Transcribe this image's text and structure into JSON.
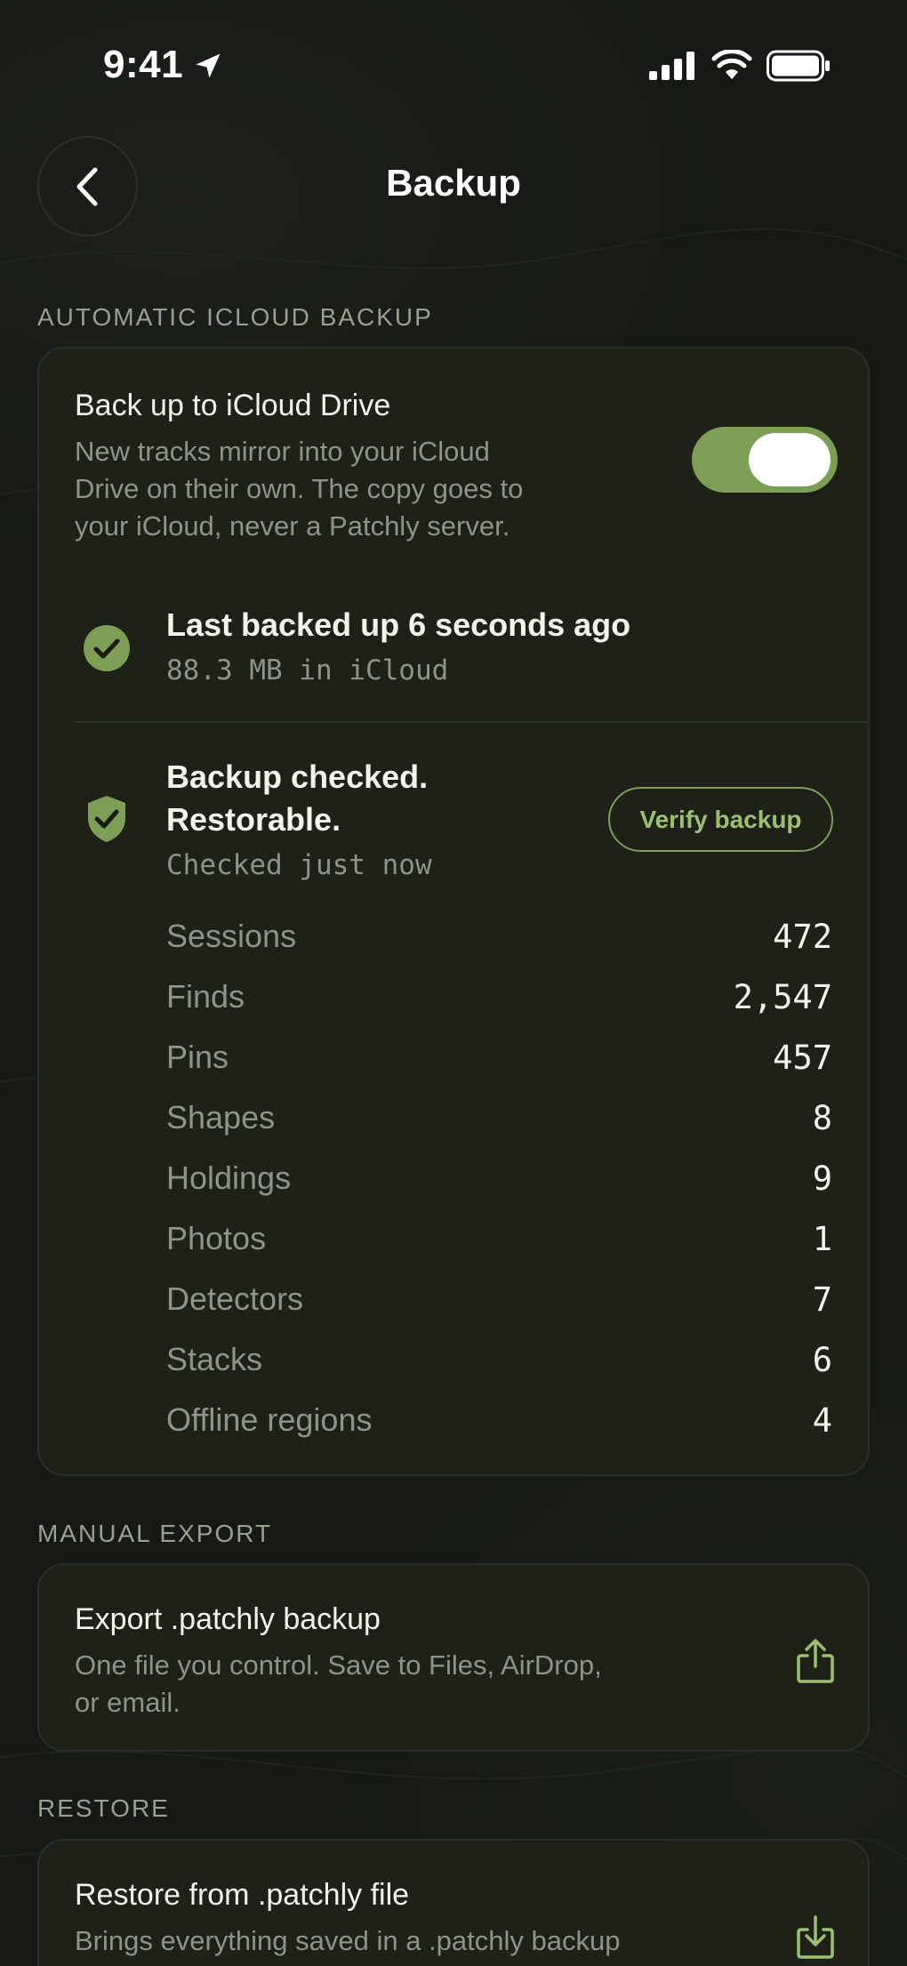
{
  "status_bar": {
    "time": "9:41"
  },
  "nav": {
    "title": "Backup"
  },
  "icloud": {
    "section_label": "AUTOMATIC ICLOUD BACKUP",
    "toggle_title": "Back up to iCloud Drive",
    "toggle_desc_lines": [
      "New tracks mirror into your iCloud",
      "Drive on their own. The copy goes to",
      "your iCloud, never a Patchly server."
    ],
    "toggle_on": true,
    "last_backup_title": "Last backed up 6 seconds ago",
    "last_backup_size": "88.3 MB in iCloud",
    "check_title_lines": [
      "Backup checked.",
      "Restorable."
    ],
    "check_time": "Checked just now",
    "verify_label": "Verify backup",
    "stats": [
      {
        "label": "Sessions",
        "value": "472"
      },
      {
        "label": "Finds",
        "value": "2,547"
      },
      {
        "label": "Pins",
        "value": "457"
      },
      {
        "label": "Shapes",
        "value": "8"
      },
      {
        "label": "Holdings",
        "value": "9"
      },
      {
        "label": "Photos",
        "value": "1"
      },
      {
        "label": "Detectors",
        "value": "7"
      },
      {
        "label": "Stacks",
        "value": "6"
      },
      {
        "label": "Offline regions",
        "value": "4"
      }
    ]
  },
  "export": {
    "section_label": "MANUAL EXPORT",
    "title": "Export .patchly backup",
    "desc_lines": [
      "One file you control. Save to Files, AirDrop,",
      "or email."
    ]
  },
  "restore": {
    "section_label": "RESTORE",
    "title": "Restore from .patchly file",
    "desc_lines": [
      "Brings everything saved in a .patchly backup"
    ]
  },
  "colors": {
    "accent": "#7d9f55",
    "accent_text": "#9cbf72",
    "background": "#161914",
    "card": "#1e2219"
  },
  "icons": [
    "location-arrow-icon",
    "signal-icon",
    "wifi-icon",
    "battery-icon",
    "chevron-left-icon",
    "check-circle-icon",
    "shield-check-icon",
    "share-icon",
    "download-icon"
  ]
}
